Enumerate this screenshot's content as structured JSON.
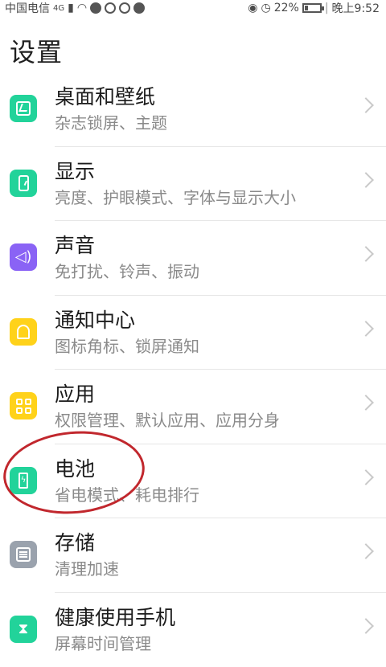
{
  "status_bar": {
    "carrier": "中国电信",
    "network": "4G",
    "battery_percent": "22%",
    "time": "晚上9:52",
    "icons": [
      "signal-icon",
      "wifi-icon",
      "app-icon",
      "app-icon",
      "app-icon",
      "app-icon",
      "eye-icon",
      "alarm-icon",
      "battery-icon"
    ]
  },
  "page": {
    "title": "设置"
  },
  "items": [
    {
      "title": "桌面和壁纸",
      "subtitle": "杂志锁屏、主题",
      "icon": "wallpaper-icon",
      "color": "#22d39a"
    },
    {
      "title": "显示",
      "subtitle": "亮度、护眼模式、字体与显示大小",
      "icon": "display-icon",
      "color": "#22d39a"
    },
    {
      "title": "声音",
      "subtitle": "免打扰、铃声、振动",
      "icon": "sound-icon",
      "color": "#8a63f5"
    },
    {
      "title": "通知中心",
      "subtitle": "图标角标、锁屏通知",
      "icon": "bell-icon",
      "color": "#ffd21a"
    },
    {
      "title": "应用",
      "subtitle": "权限管理、默认应用、应用分身",
      "icon": "apps-icon",
      "color": "#ffd21a"
    },
    {
      "title": "电池",
      "subtitle": "省电模式、耗电排行",
      "icon": "battery-icon",
      "color": "#22d39a"
    },
    {
      "title": "存储",
      "subtitle": "清理加速",
      "icon": "storage-icon",
      "color": "#9aa2ad"
    },
    {
      "title": "健康使用手机",
      "subtitle": "屏幕时间管理",
      "icon": "hourglass-icon",
      "color": "#22d39a"
    }
  ],
  "annotation": {
    "highlight": "电池",
    "color": "#c1272d"
  }
}
